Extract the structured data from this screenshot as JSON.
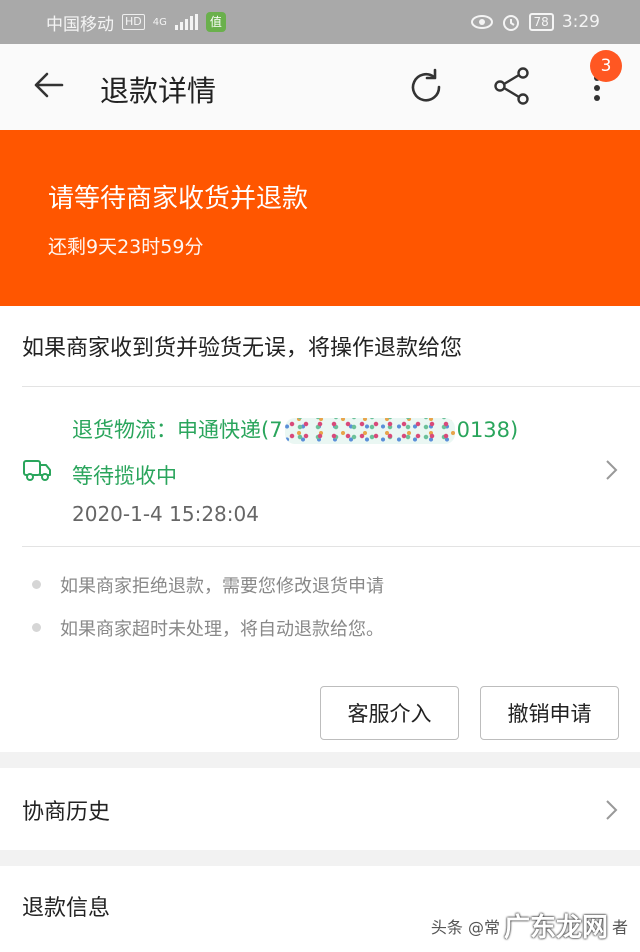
{
  "statusbar": {
    "carrier": "中国移动",
    "hd_tag": "HD",
    "network": "4G",
    "battery": "78",
    "time": "3:29"
  },
  "navbar": {
    "title": "退款详情",
    "badge_count": "3"
  },
  "banner": {
    "title": "请等待商家收货并退款",
    "countdown": "还剩9天23时59分"
  },
  "info": {
    "message": "如果商家收到货并验货无误，将操作退款给您"
  },
  "logistics": {
    "label_prefix": "退货物流：申通快递(",
    "number_prefix": "7",
    "number_suffix": "0138)",
    "status": "等待揽收中",
    "time": "2020-1-4 15:28:04"
  },
  "notes": [
    "如果商家拒绝退款，需要您修改退货申请",
    "如果商家超时未处理，将自动退款给您。"
  ],
  "actions": {
    "customer_service": "客服介入",
    "cancel_request": "撤销申请"
  },
  "sections": {
    "history": "协商历史",
    "refund_info": "退款信息"
  },
  "watermark": {
    "prefix": "头条 @常",
    "overlay": "广东龙网",
    "suffix": "者"
  },
  "colors": {
    "accent_orange": "#ff5600",
    "logistics_green": "#2aa55c"
  }
}
